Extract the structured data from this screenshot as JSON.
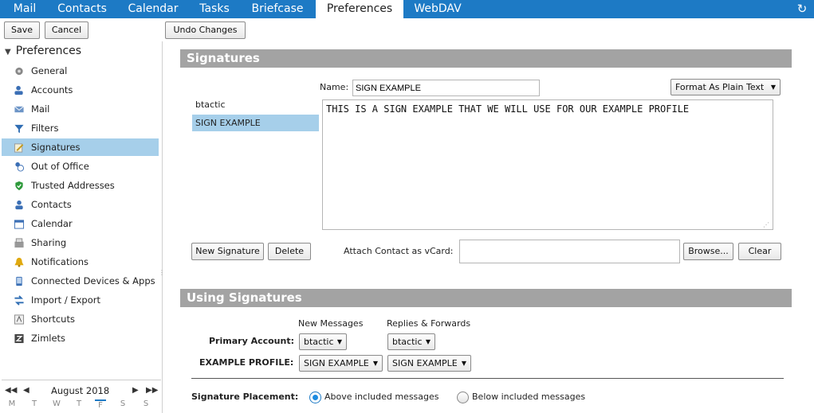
{
  "app_tabs": [
    "Mail",
    "Contacts",
    "Calendar",
    "Tasks",
    "Briefcase",
    "Preferences",
    "WebDAV"
  ],
  "toolbar": {
    "save": "Save",
    "cancel": "Cancel",
    "undo": "Undo Changes"
  },
  "tree": {
    "header": "Preferences",
    "items": [
      {
        "label": "General",
        "icon": "gear-icon"
      },
      {
        "label": "Accounts",
        "icon": "accounts-icon"
      },
      {
        "label": "Mail",
        "icon": "mail-icon"
      },
      {
        "label": "Filters",
        "icon": "filter-icon"
      },
      {
        "label": "Signatures",
        "icon": "signature-icon"
      },
      {
        "label": "Out of Office",
        "icon": "out-of-office-icon"
      },
      {
        "label": "Trusted Addresses",
        "icon": "shield-check-icon"
      },
      {
        "label": "Contacts",
        "icon": "contacts-icon"
      },
      {
        "label": "Calendar",
        "icon": "calendar-icon"
      },
      {
        "label": "Sharing",
        "icon": "sharing-icon"
      },
      {
        "label": "Notifications",
        "icon": "bell-icon"
      },
      {
        "label": "Connected Devices & Apps",
        "icon": "device-icon"
      },
      {
        "label": "Import / Export",
        "icon": "import-export-icon"
      },
      {
        "label": "Shortcuts",
        "icon": "shortcuts-icon"
      },
      {
        "label": "Zimlets",
        "icon": "zimlet-icon"
      }
    ],
    "selected": "Signatures"
  },
  "mini_calendar": {
    "month": "August 2018",
    "weekdays": [
      "M",
      "T",
      "W",
      "T",
      "F",
      "S",
      "S"
    ]
  },
  "signatures": {
    "section_title": "Signatures",
    "list": [
      "btactic",
      "SIGN EXAMPLE"
    ],
    "selected": "SIGN EXAMPLE",
    "name_label": "Name:",
    "name_value": "SIGN EXAMPLE",
    "format": "Format As Plain Text",
    "body": "THIS IS A SIGN EXAMPLE THAT WE WILL USE FOR OUR EXAMPLE PROFILE",
    "new_button": "New Signature",
    "delete_button": "Delete",
    "vcard_label": "Attach Contact as vCard:",
    "vcard_value": "",
    "browse_button": "Browse...",
    "clear_button": "Clear"
  },
  "using": {
    "section_title": "Using Signatures",
    "col_new": "New Messages",
    "col_replies": "Replies & Forwards",
    "rows": [
      {
        "label": "Primary Account:",
        "new": "btactic",
        "replies": "btactic"
      },
      {
        "label": "EXAMPLE PROFILE:",
        "new": "SIGN EXAMPLE",
        "replies": "SIGN EXAMPLE"
      }
    ],
    "placement_label": "Signature Placement:",
    "placement_above": "Above included messages",
    "placement_below": "Below included messages",
    "placement_selected": "above"
  },
  "colors": {
    "accent": "#1d7ac5",
    "selection": "#a6cfea",
    "section_header": "#a3a3a3"
  }
}
